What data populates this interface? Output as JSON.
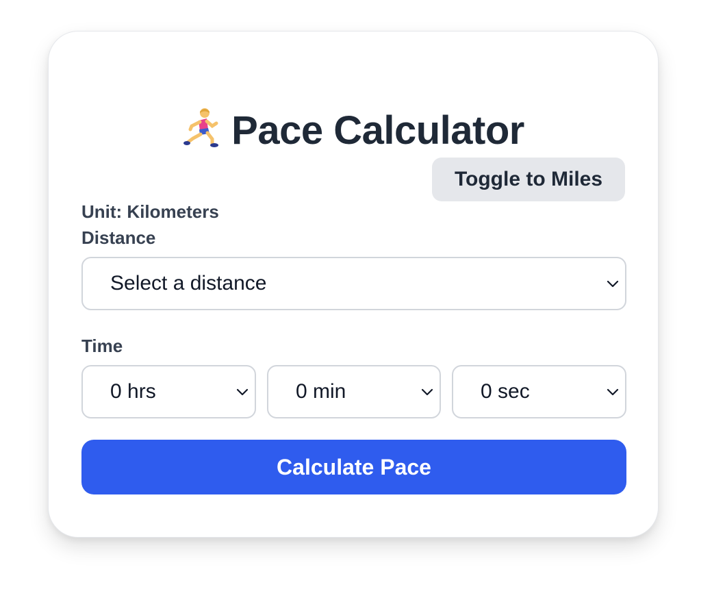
{
  "app": {
    "title": "Pace Calculator",
    "icon": "runner-icon"
  },
  "unit": {
    "label": "Unit: Kilometers",
    "toggle_label": "Toggle to Miles"
  },
  "distance": {
    "label": "Distance",
    "selected": "Select a distance"
  },
  "time": {
    "label": "Time",
    "hours": "0 hrs",
    "minutes": "0 min",
    "seconds": "0 sec"
  },
  "actions": {
    "calculate_label": "Calculate Pace"
  },
  "colors": {
    "accent": "#2f5cee",
    "toggle_bg": "#e5e7eb",
    "heading": "#1f2937",
    "label": "#374151",
    "border": "#d1d5db"
  }
}
